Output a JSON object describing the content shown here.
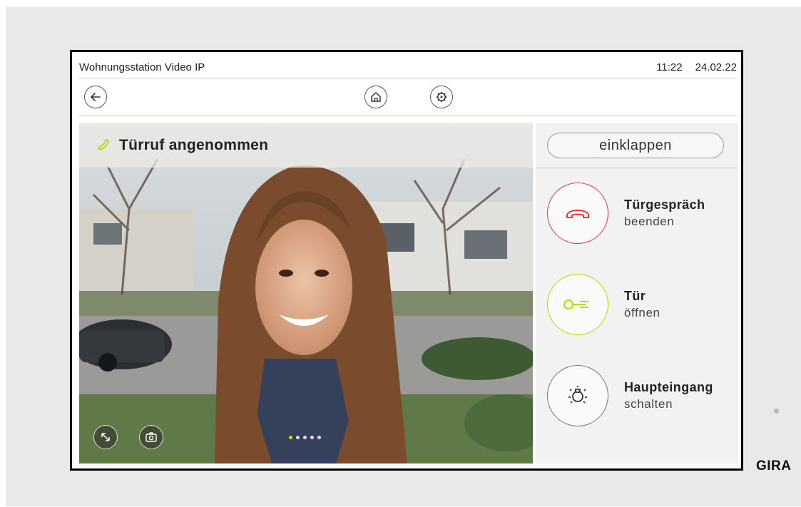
{
  "status_bar": {
    "title": "Wohnungsstation Video IP",
    "time": "11:22",
    "date": "24.02.22"
  },
  "toolbar": {
    "back_icon": "arrow-left-icon",
    "home_icon": "home-icon",
    "settings_icon": "gear-play-icon"
  },
  "video": {
    "header_title": "Türruf angenommen",
    "phone_icon": "phone-icon",
    "expand_icon": "expand-diagonal-icon",
    "camera_icon": "camera-icon",
    "page_indicator": {
      "total": 5,
      "active": 1
    }
  },
  "side_panel": {
    "collapse_label": "einklappen",
    "actions": [
      {
        "title": "Türgespräch",
        "subtitle": "beenden",
        "icon": "hang-up-icon",
        "color": "#e4393c"
      },
      {
        "title": "Tür",
        "subtitle": "öffnen",
        "icon": "key-icon",
        "color": "#b8d800"
      },
      {
        "title": "Haupteingang",
        "subtitle": "schalten",
        "icon": "light-bulb-icon",
        "color": "#666666"
      }
    ]
  },
  "brand": "GIRA"
}
